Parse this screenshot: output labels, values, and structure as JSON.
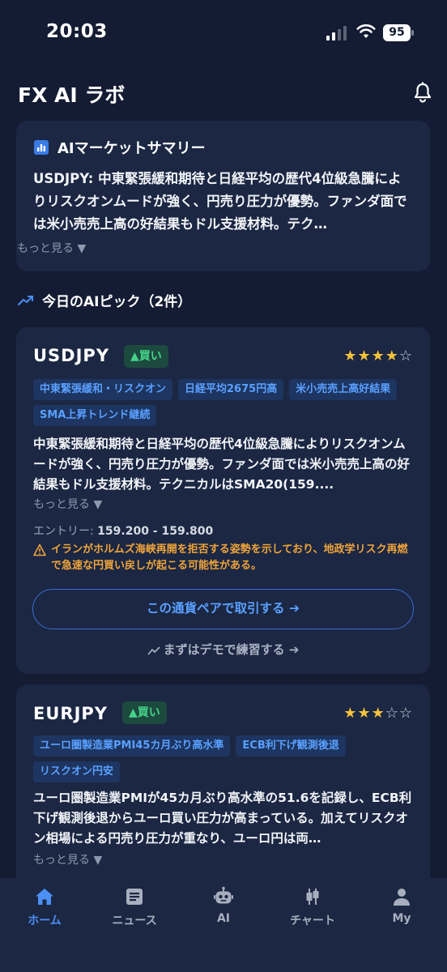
{
  "status_bar": {
    "time": "20:03",
    "battery": "95"
  },
  "header": {
    "title": "FX AI ラボ"
  },
  "summary": {
    "title": "AIマーケットサマリー",
    "text": "USDJPY: 中東緊張緩和期待と日経平均の歴代4位級急騰によりリスクオンムードが強く、円売り圧力が優勢。ファンダ面では米小売売上高の好結果もドル支援材料。テク…",
    "more": "もっと見る ▼"
  },
  "picks": {
    "title": "今日のAIピック（2件）",
    "items": [
      {
        "pair": "USDJPY",
        "signal": "▲買い",
        "stars": "★★★★☆",
        "tags": [
          "中東緊張緩和・リスクオン",
          "日経平均2675円高",
          "米小売売上高好結果",
          "SMA上昇トレンド継続"
        ],
        "text": "中東緊張緩和期待と日経平均の歴代4位級急騰によりリスクオンムードが強く、円売り圧力が優勢。ファンダ面では米小売売上高の好結果もドル支援材料。テクニカルはSMA20(159....",
        "more": "もっと見る ▼",
        "entry_label": "エントリー:",
        "entry_value": "159.200 - 159.800",
        "warning": "イランがホルムズ海峡再開を拒否する姿勢を示しており、地政学リスク再燃で急速な円買い戻しが起こる可能性がある。",
        "trade_button": "この通貨ペアで取引する ➔",
        "demo_link": "まずはデモで練習する ➔"
      },
      {
        "pair": "EURJPY",
        "signal": "▲買い",
        "stars": "★★★☆☆",
        "tags": [
          "ユーロ圏製造業PMI45カ月ぶり高水準",
          "ECB利下げ観測後退",
          "リスクオン円安"
        ],
        "text": "ユーロ圏製造業PMIが45カ月ぶり高水準の51.6を記録し、ECB利下げ観測後退からユーロ買い圧力が高まっている。加えてリスクオン相場による円売り圧力が重なり、ユーロ円は両…",
        "more": "もっと見る ▼"
      }
    ]
  },
  "tabs": [
    {
      "label": "ホーム",
      "icon": "home-icon"
    },
    {
      "label": "ニュース",
      "icon": "news-icon"
    },
    {
      "label": "AI",
      "icon": "robot-icon"
    },
    {
      "label": "チャート",
      "icon": "candlestick-icon"
    },
    {
      "label": "My",
      "icon": "person-icon"
    }
  ],
  "colors": {
    "background": "#141c33",
    "card": "#1b2743",
    "accent": "#4c8ff5",
    "buy": "#45d38a",
    "star": "#f5c23a",
    "warning": "#f0a43a"
  }
}
